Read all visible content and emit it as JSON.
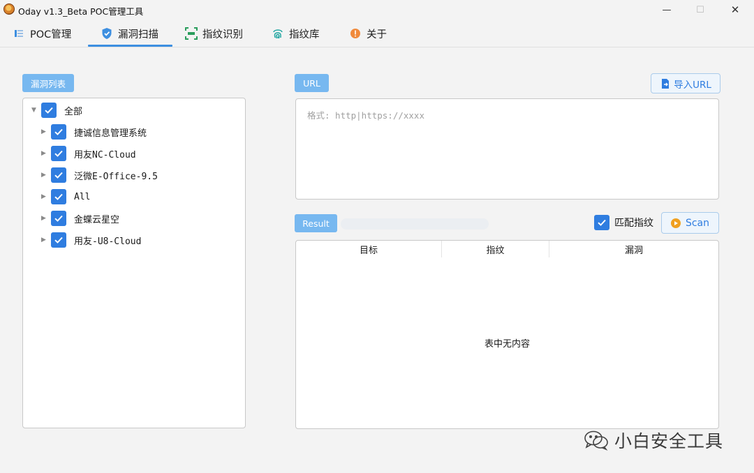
{
  "window": {
    "title": "Oday v1.3_Beta POC管理工具",
    "controls": {
      "minimize": "—",
      "maximize": "☐",
      "close": "✕"
    }
  },
  "tabs": [
    {
      "label": "POC管理",
      "icon": "list-icon",
      "active": false
    },
    {
      "label": "漏洞扫描",
      "icon": "shield-icon",
      "active": true
    },
    {
      "label": "指纹识别",
      "icon": "scan-frame-icon",
      "active": false
    },
    {
      "label": "指纹库",
      "icon": "fingerprint-icon",
      "active": false
    },
    {
      "label": "关于",
      "icon": "info-icon",
      "active": false
    }
  ],
  "vuln_list": {
    "tag": "漏洞列表",
    "root": {
      "label": "全部",
      "checked": true,
      "expanded": true
    },
    "items": [
      {
        "label": "捷诚信息管理系统",
        "checked": true
      },
      {
        "label": "用友NC-Cloud",
        "checked": true
      },
      {
        "label": "泛微E-Office-9.5",
        "checked": true
      },
      {
        "label": "All",
        "checked": true
      },
      {
        "label": "金蝶云星空",
        "checked": true
      },
      {
        "label": "用友-U8-Cloud",
        "checked": true
      }
    ]
  },
  "url_section": {
    "tag": "URL",
    "import_button": "导入URL",
    "placeholder": "格式: http|https://xxxx"
  },
  "result_section": {
    "tag": "Result",
    "progress": 0,
    "match_fingerprint": {
      "label": "匹配指纹",
      "checked": true
    },
    "scan_button": "Scan",
    "columns": [
      "目标",
      "指纹",
      "漏洞"
    ],
    "empty_text": "表中无内容"
  },
  "watermark": {
    "text": "小白安全工具"
  },
  "colors": {
    "accent": "#2f7de0",
    "tag": "#77b8f0",
    "scan_icon": "#f0a020"
  }
}
